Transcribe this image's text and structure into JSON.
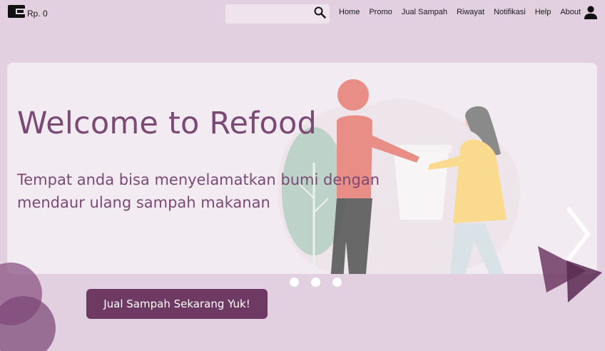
{
  "header": {
    "wallet_icon": "wallet-icon",
    "wallet_amount": "Rp. 0",
    "search": {
      "value": "",
      "placeholder": "",
      "icon": "search-icon"
    },
    "nav": [
      {
        "label": "Home"
      },
      {
        "label": "Promo"
      },
      {
        "label": "Jual Sampah"
      },
      {
        "label": "Riwayat"
      },
      {
        "label": "Notifikasi"
      },
      {
        "label": "Help"
      },
      {
        "label": "About"
      }
    ],
    "user_icon": "user-icon"
  },
  "hero": {
    "title": "Welcome to Refood",
    "subtitle": "Tempat anda bisa menyelamatkan bumi dengan mendaur ulang sampah makanan",
    "next_icon": "chevron-right-icon",
    "slides_count": 3
  },
  "cta": {
    "label": "Jual Sampah Sekarang Yuk!"
  },
  "colors": {
    "background": "#e2cfe0",
    "primary": "#6e3a64",
    "title_text": "#7a4a74",
    "hero_panel": "#f6f0f5"
  }
}
